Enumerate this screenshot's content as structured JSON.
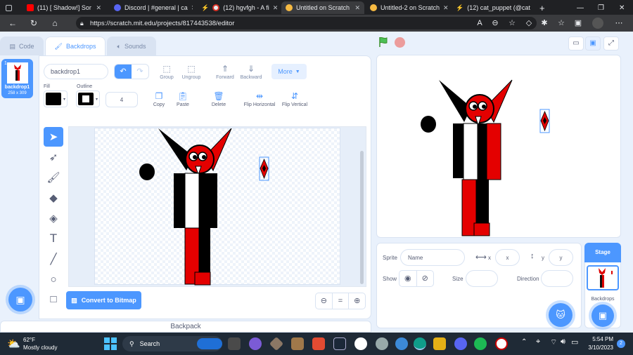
{
  "browser": {
    "tabs": [
      {
        "label": "(11) [ Shadow!] Sor",
        "color": "#ff0000"
      },
      {
        "label": "Discord | #general | ca",
        "color": "#5865f2"
      },
      {
        "label": "(12) hgvfgh - A fi",
        "color": "#ffffff"
      },
      {
        "label": "Untitled on Scratch",
        "color": "#f5b942"
      },
      {
        "label": "Untitled-2 on Scratch",
        "color": "#f5b942"
      },
      {
        "label": "(12) cat_puppet (@cat",
        "color": "#ffffff"
      }
    ],
    "url": "https://scratch.mit.edu/projects/817443538/editor"
  },
  "editor_tabs": {
    "code": "Code",
    "backdrops": "Backdrops",
    "sounds": "Sounds"
  },
  "backdrop_list": {
    "number": "1",
    "name": "backdrop1",
    "size": "258 x 309"
  },
  "paint": {
    "costume_name": "backdrop1",
    "group": "Group",
    "ungroup": "Ungroup",
    "forward": "Forward",
    "backward": "Backward",
    "more": "More",
    "fill_label": "Fill",
    "outline_label": "Outline",
    "outline_width": "4",
    "copy": "Copy",
    "paste": "Paste",
    "delete": "Delete",
    "flip_h": "Flip Horizontal",
    "flip_v": "Flip Vertical",
    "convert": "Convert to Bitmap",
    "zoom_reset": "="
  },
  "backpack": "Backpack",
  "sprite_info": {
    "sprite_label": "Sprite",
    "name_placeholder": "Name",
    "x_label": "x",
    "x_placeholder": "x",
    "y_label": "y",
    "y_placeholder": "y",
    "show_label": "Show",
    "size_label": "Size",
    "direction_label": "Direction"
  },
  "stage_panel": {
    "title": "Stage",
    "backdrops_label": "Backdrops"
  },
  "taskbar": {
    "weather_temp": "62°F",
    "weather_desc": "Mostly cloudy",
    "search": "Search",
    "time": "5:54 PM",
    "date": "3/10/2023",
    "badge": "2"
  }
}
